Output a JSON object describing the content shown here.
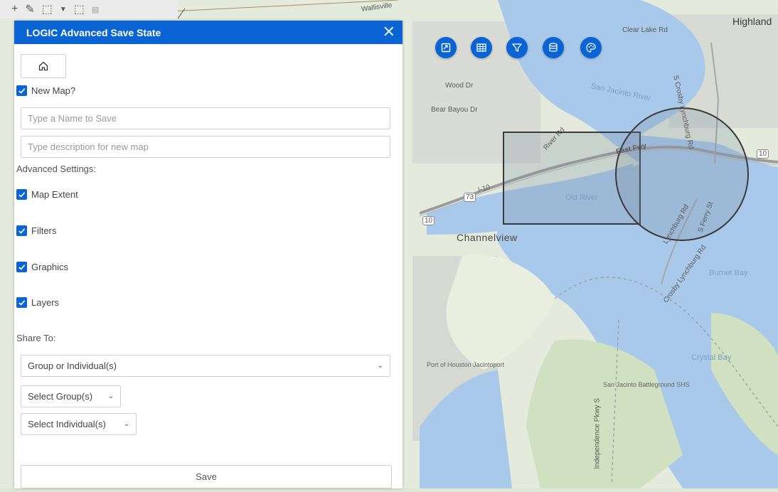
{
  "toolbar": {
    "tool_icons": [
      "plus-icon",
      "pencil-icon",
      "select-rect-icon",
      "caret-down-icon",
      "select-pointer-icon",
      "legend-icon"
    ]
  },
  "map": {
    "labels": {
      "highlands": "Highland",
      "clear_lake_rd": "Clear Lake Rd",
      "wood_dr": "Wood Dr",
      "bear_bayou_dr": "Bear Bayou Dr",
      "san_jacinto_river": "San Jacinto River",
      "crosby_lynchburg_rd_north": "S Crosby Lynchburg Rd",
      "east_fwy": "East Fwy",
      "old_river": "Old River",
      "i10": "I-10",
      "i10_shield_left": "10",
      "i10_shield_right": "10",
      "sh73": "73",
      "river_rd": "River Rd",
      "lynchburg_rd": "Lynchburg Rd",
      "s_ferry_st": "S Ferry St",
      "channelview": "Channelview",
      "crosby_lynchburg_rd_south": "Crosby Lynchburg Rd",
      "burnet_bay": "Burnet Bay",
      "crystal_bay": "Crystal Bay",
      "port_of_houston": "Port of Houston Jacintoport",
      "san_jacinto_battleground": "San Jacinto Battleground SHS",
      "independence_pkwy": "Independence Pkwy S",
      "wallisville": "Wallisville"
    },
    "tool_buttons": [
      {
        "name": "save-state-button",
        "icon": "bookmark-icon"
      },
      {
        "name": "table-button",
        "icon": "table-icon"
      },
      {
        "name": "filter-button",
        "icon": "filter-icon"
      },
      {
        "name": "layers-db-button",
        "icon": "database-icon"
      },
      {
        "name": "style-button",
        "icon": "palette-icon"
      }
    ]
  },
  "panel": {
    "title": "LOGIC Advanced Save State",
    "close_icon": "close-icon",
    "home_icon": "home-icon",
    "new_map_label": "New Map?",
    "new_map_checked": true,
    "name_placeholder": "Type a Name to Save",
    "name_value": "",
    "description_placeholder": "Type description for new map",
    "description_value": "",
    "advanced_settings_label": "Advanced Settings:",
    "settings": [
      {
        "label": "Map Extent",
        "checked": true
      },
      {
        "label": "Filters",
        "checked": true
      },
      {
        "label": "Graphics",
        "checked": true
      },
      {
        "label": "Layers",
        "checked": true
      }
    ],
    "share_to_label": "Share To:",
    "share_select": "Group or Individual(s)",
    "group_select": "Select Group(s)",
    "individual_select": "Select Individual(s)",
    "save_label": "Save"
  },
  "colors": {
    "accent": "#0a64d4",
    "water": "#a9c9ea",
    "land": "#e2ead9",
    "park": "#cfe1c0"
  }
}
